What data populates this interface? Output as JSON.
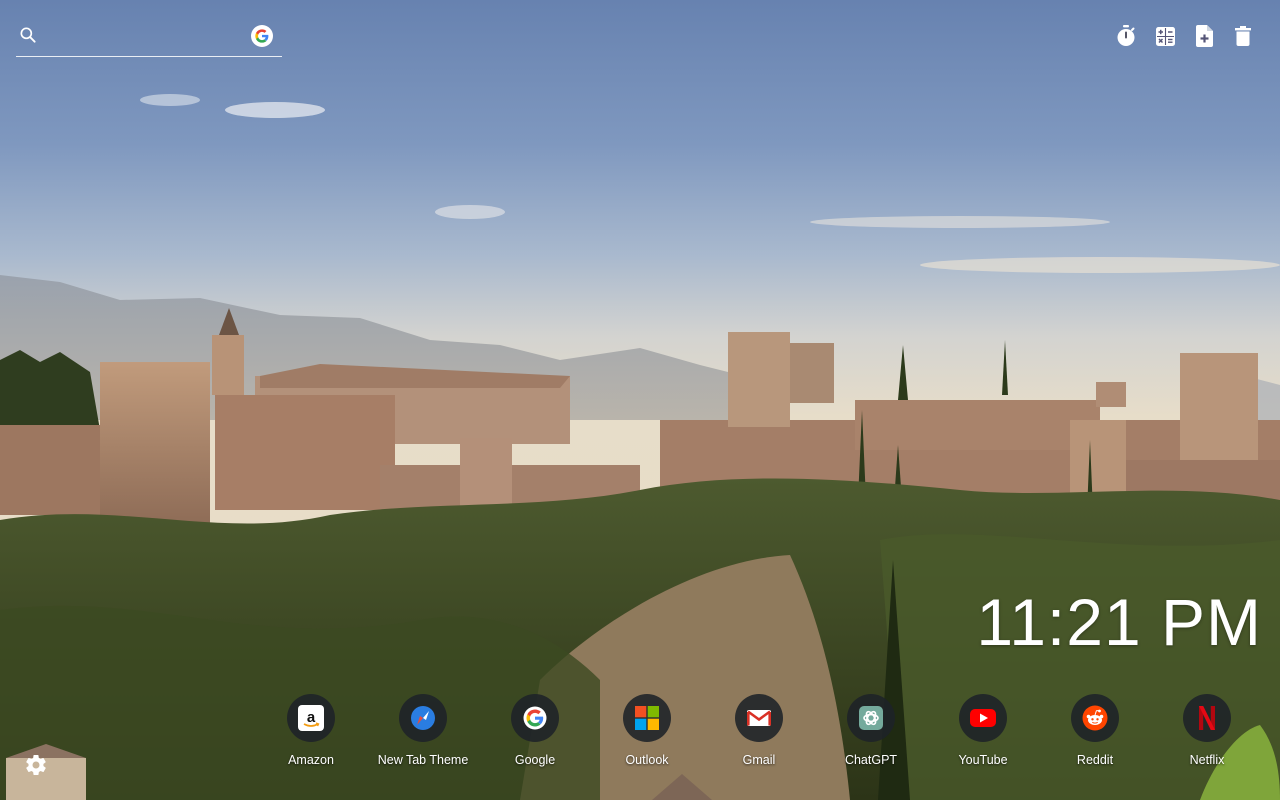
{
  "search": {
    "placeholder": "",
    "value": "",
    "search_icon": "search-icon",
    "engine_icon": "google-icon"
  },
  "toolbar": {
    "items": [
      {
        "name": "timer",
        "icon": "stopwatch-icon"
      },
      {
        "name": "calculator",
        "icon": "calculator-icon"
      },
      {
        "name": "new-note",
        "icon": "note-add-icon"
      },
      {
        "name": "delete",
        "icon": "trash-icon"
      }
    ]
  },
  "clock": {
    "time": "11:21 PM"
  },
  "shortcuts": [
    {
      "label": "Amazon",
      "icon": "amazon-icon"
    },
    {
      "label": "New Tab Theme",
      "icon": "compass-icon"
    },
    {
      "label": "Google",
      "icon": "google-icon"
    },
    {
      "label": "Outlook",
      "icon": "microsoft-icon"
    },
    {
      "label": "Gmail",
      "icon": "gmail-icon"
    },
    {
      "label": "ChatGPT",
      "icon": "chatgpt-icon"
    },
    {
      "label": "YouTube",
      "icon": "youtube-icon"
    },
    {
      "label": "Reddit",
      "icon": "reddit-icon"
    },
    {
      "label": "Netflix",
      "icon": "netflix-icon"
    }
  ],
  "settings": {
    "icon": "gear-icon"
  },
  "colors": {
    "sky_top": "#6b87b4",
    "sky_mid": "#a9b8c8",
    "sky_horizon": "#e4dccb",
    "fortress": "#b08c73",
    "foliage": "#41512a",
    "dock_circle": "#1e2228"
  }
}
